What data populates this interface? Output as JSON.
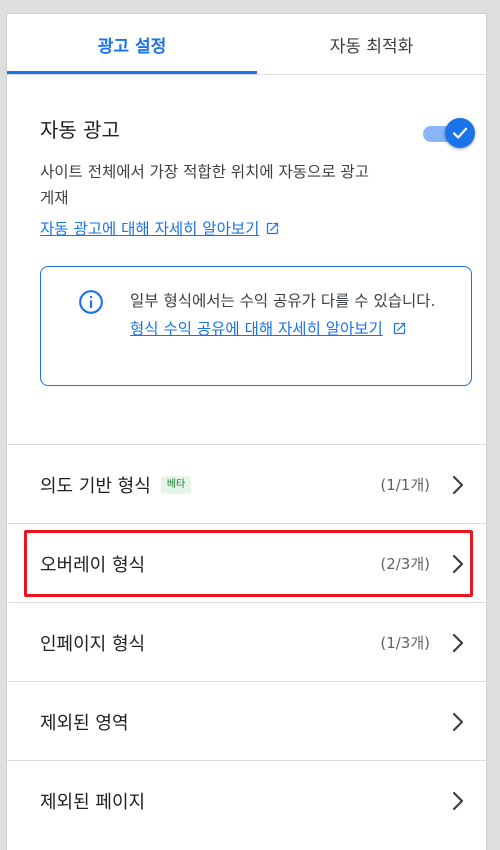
{
  "tabs": [
    {
      "label": "광고 설정",
      "active": true
    },
    {
      "label": "자동 최적화",
      "active": false
    }
  ],
  "auto_ads": {
    "title": "자동 광고",
    "toggle_on": true,
    "description": "사이트 전체에서 가장 적합한 위치에 자동으로 광고 게재",
    "learn_more": "자동 광고에 대해 자세히 알아보기"
  },
  "info": {
    "text": "일부 형식에서는 수익 공유가 다를 수 있습니다.",
    "link": "형식 수익 공유에 대해 자세히 알아보기"
  },
  "rows": [
    {
      "label": "의도 기반 형식",
      "badge": "베타",
      "count": "(1/1개)"
    },
    {
      "label": "오버레이 형식",
      "badge": "",
      "count": "(2/3개)",
      "highlighted": true
    },
    {
      "label": "인페이지 형식",
      "badge": "",
      "count": "(1/3개)"
    },
    {
      "label": "제외된 영역",
      "badge": "",
      "count": ""
    },
    {
      "label": "제외된 페이지",
      "badge": "",
      "count": ""
    }
  ],
  "colors": {
    "accent": "#1a73e8",
    "highlight": "#e8141e",
    "beta_bg": "#e6f4ea",
    "beta_text": "#188038"
  },
  "icons": {
    "toggle": "check-icon",
    "external": "open-in-new-icon",
    "info": "info-icon",
    "chevron": "chevron-right-icon"
  }
}
